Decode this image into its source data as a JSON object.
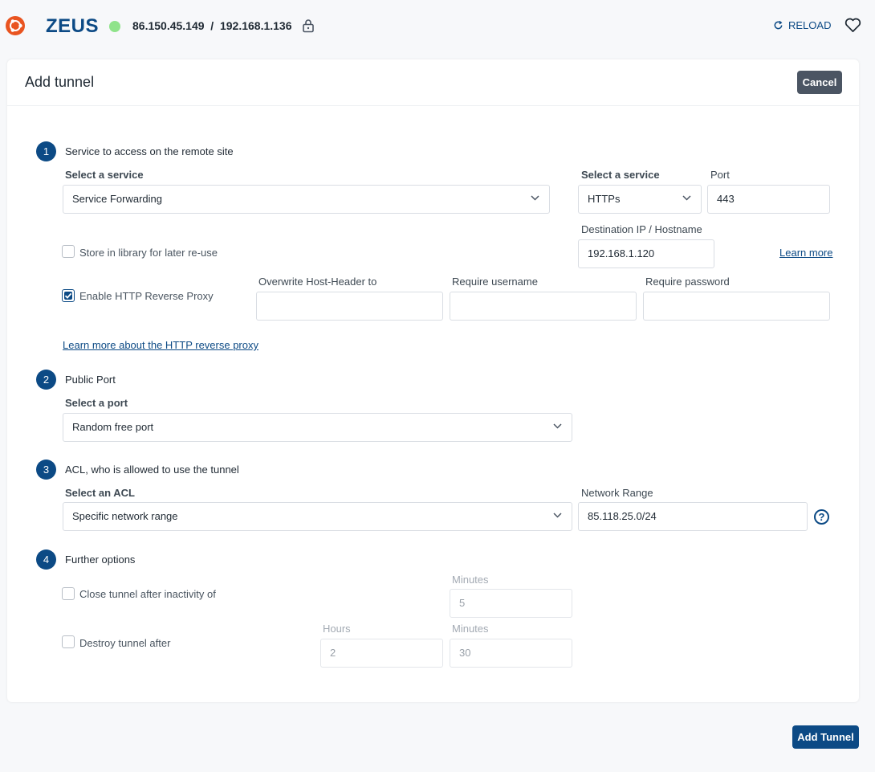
{
  "header": {
    "host_name": "ZEUS",
    "ip_address": "86.150.45.149  /  192.168.1.136",
    "reload_label": "RELOAD",
    "status_color": "#8fe38a"
  },
  "card": {
    "title": "Add tunnel",
    "cancel_label": "Cancel"
  },
  "step1": {
    "number": "1",
    "title": "Service to access on the remote site",
    "service_label": "Select a service",
    "service_value": "Service Forwarding",
    "protocol_label": "Select a service",
    "protocol_value": "HTTPs",
    "port_label": "Port",
    "port_value": "443",
    "destination_label": "Destination IP / Hostname",
    "destination_value": "192.168.1.120",
    "store_label": "Store in library for later re-use",
    "store_checked": false,
    "learn_more": "Learn more",
    "proxy_label": "Enable HTTP Reverse Proxy",
    "proxy_checked": true,
    "host_header_label": "Overwrite Host-Header to",
    "host_header_value": "",
    "username_label": "Require username",
    "username_value": "",
    "password_label": "Require password",
    "password_value": "",
    "proxy_link": "Learn more about the HTTP reverse proxy"
  },
  "step2": {
    "number": "2",
    "title": "Public Port",
    "port_label": "Select a port",
    "port_value": "Random free port"
  },
  "step3": {
    "number": "3",
    "title": "ACL, who is allowed to use the tunnel",
    "acl_label": "Select an ACL",
    "acl_value": "Specific network range",
    "range_label": "Network Range",
    "range_value": "85.118.25.0/24",
    "help_glyph": "?"
  },
  "step4": {
    "number": "4",
    "title": "Further options",
    "inactivity_label": "Close tunnel after inactivity of",
    "inactivity_checked": false,
    "inactivity_minutes_label": "Minutes",
    "inactivity_minutes": "5",
    "destroy_label": "Destroy tunnel after",
    "destroy_checked": false,
    "destroy_hours_label": "Hours",
    "destroy_hours": "2",
    "destroy_minutes_label": "Minutes",
    "destroy_minutes": "30"
  },
  "footer": {
    "add_label": "Add Tunnel"
  },
  "colors": {
    "accent": "#0c4a85",
    "ubuntu": "#e95420",
    "cancel": "#4b5563"
  }
}
